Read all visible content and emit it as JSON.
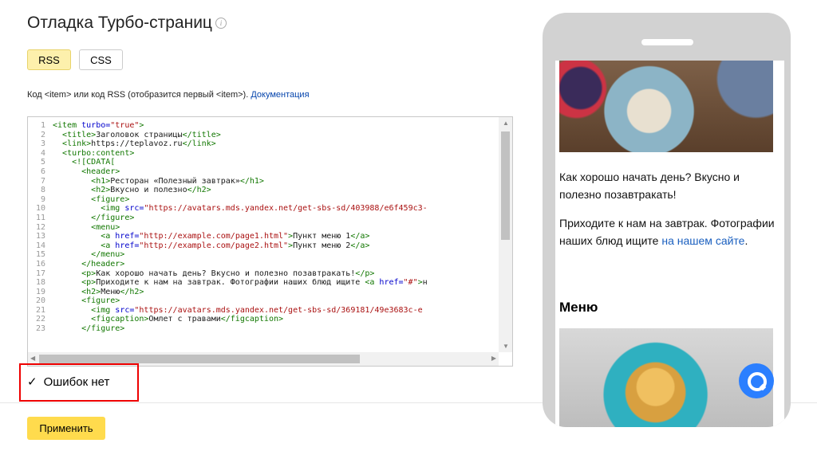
{
  "page": {
    "title": "Отладка Турбо-страниц",
    "info_glyph": "i"
  },
  "tabs": [
    {
      "label": "RSS",
      "active": true
    },
    {
      "label": "CSS",
      "active": false
    }
  ],
  "hint": {
    "text": "Код <item> или код RSS (отобразится первый <item>).",
    "link": "Документация"
  },
  "editor": {
    "lines": [
      {
        "n": "1",
        "html": "<span class=\"tag\">&lt;item</span> <span class=\"attr\">turbo=</span><span class=\"str\">\"true\"</span><span class=\"tag\">&gt;</span>"
      },
      {
        "n": "2",
        "html": "  <span class=\"tag\">&lt;title&gt;</span>Заголовок страницы<span class=\"tag\">&lt;/title&gt;</span>"
      },
      {
        "n": "3",
        "html": "  <span class=\"tag\">&lt;link&gt;</span>https://teplavoz.ru<span class=\"tag\">&lt;/link&gt;</span>"
      },
      {
        "n": "4",
        "html": "  <span class=\"tag\">&lt;turbo:content&gt;</span>"
      },
      {
        "n": "5",
        "html": "    <span class=\"tag\">&lt;![CDATA[</span>"
      },
      {
        "n": "6",
        "html": "      <span class=\"tag\">&lt;header&gt;</span>"
      },
      {
        "n": "7",
        "html": "        <span class=\"tag\">&lt;h1&gt;</span>Ресторан «Полезный завтрак»<span class=\"tag\">&lt;/h1&gt;</span>"
      },
      {
        "n": "8",
        "html": "        <span class=\"tag\">&lt;h2&gt;</span>Вкусно и полезно<span class=\"tag\">&lt;/h2&gt;</span>"
      },
      {
        "n": "9",
        "html": "        <span class=\"tag\">&lt;figure&gt;</span>"
      },
      {
        "n": "10",
        "html": "          <span class=\"tag\">&lt;img</span> <span class=\"attr\">src=</span><span class=\"str\">\"https://avatars.mds.yandex.net/get-sbs-sd/403988/e6f459c3-</span>"
      },
      {
        "n": "11",
        "html": "        <span class=\"tag\">&lt;/figure&gt;</span>"
      },
      {
        "n": "12",
        "html": "        <span class=\"tag\">&lt;menu&gt;</span>"
      },
      {
        "n": "13",
        "html": "          <span class=\"tag\">&lt;a</span> <span class=\"attr\">href=</span><span class=\"str\">\"http://example.com/page1.html\"</span><span class=\"tag\">&gt;</span>Пункт меню 1<span class=\"tag\">&lt;/a&gt;</span>"
      },
      {
        "n": "14",
        "html": "          <span class=\"tag\">&lt;a</span> <span class=\"attr\">href=</span><span class=\"str\">\"http://example.com/page2.html\"</span><span class=\"tag\">&gt;</span>Пункт меню 2<span class=\"tag\">&lt;/a&gt;</span>"
      },
      {
        "n": "15",
        "html": "        <span class=\"tag\">&lt;/menu&gt;</span>"
      },
      {
        "n": "16",
        "html": "      <span class=\"tag\">&lt;/header&gt;</span>"
      },
      {
        "n": "17",
        "html": "      <span class=\"tag\">&lt;p&gt;</span>Как хорошо начать день? Вкусно и полезно позавтракать!<span class=\"tag\">&lt;/p&gt;</span>"
      },
      {
        "n": "18",
        "html": "      <span class=\"tag\">&lt;p&gt;</span>Приходите к нам на завтрак. Фотографии наших блюд ищите <span class=\"tag\">&lt;a</span> <span class=\"attr\">href=</span><span class=\"str\">\"#\"</span><span class=\"tag\">&gt;</span>н"
      },
      {
        "n": "19",
        "html": "      <span class=\"tag\">&lt;h2&gt;</span>Меню<span class=\"tag\">&lt;/h2&gt;</span>"
      },
      {
        "n": "20",
        "html": "      <span class=\"tag\">&lt;figure&gt;</span>"
      },
      {
        "n": "21",
        "html": "        <span class=\"tag\">&lt;img</span> <span class=\"attr\">src=</span><span class=\"str\">\"https://avatars.mds.yandex.net/get-sbs-sd/369181/49e3683c-e</span>"
      },
      {
        "n": "22",
        "html": "        <span class=\"tag\">&lt;figcaption&gt;</span>Омлет с травами<span class=\"tag\">&lt;/figcaption&gt;</span>"
      },
      {
        "n": "23",
        "html": "      <span class=\"tag\">&lt;/figure&gt;</span>"
      }
    ]
  },
  "status": {
    "check": "✓",
    "text": "Ошибок нет"
  },
  "apply_label": "Применить",
  "preview": {
    "p1": "Как хорошо начать день? Вкусно и полезно позавтракать!",
    "p2": "Приходите к нам на завтрак. Фотографии наших блюд ищите",
    "p2_link": "на нашем сайте",
    "p2_end": ".",
    "heading": "Меню"
  }
}
